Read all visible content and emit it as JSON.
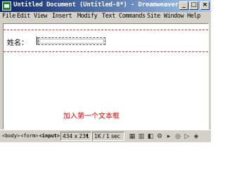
{
  "window": {
    "title": "Untitled Document (Untitled-8*) - Dreamweaver",
    "controls": {
      "minimize": "_",
      "maximize": "□",
      "close": "×"
    }
  },
  "menubar": {
    "items": [
      "File",
      "Edit",
      "View",
      "Insert",
      "Modify",
      "Text",
      "Commands",
      "Site",
      "Window",
      "Help"
    ]
  },
  "document": {
    "field_label": "姓名：",
    "caption": "加入第一个文本框"
  },
  "statusbar": {
    "tags": [
      "<body>",
      "<form>",
      "<input>"
    ],
    "window_size": "434 x 231",
    "download_stats": "1K / 1 sec",
    "launcher_icons": [
      "site-icon",
      "library-icon",
      "styles-icon",
      "behaviors-icon",
      "timeline-icon",
      "html-source-icon",
      "preview-icon",
      "code-icon"
    ]
  },
  "colors": {
    "titlebar_start": "#0a246a",
    "titlebar_end": "#a6caf0",
    "form_boundary": "#e03030",
    "caption": "#e00000",
    "chrome": "#d4d0c8"
  }
}
